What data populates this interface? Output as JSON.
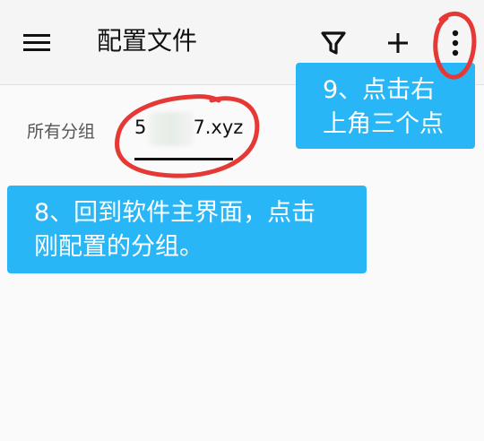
{
  "app_bar": {
    "title": "配置文件",
    "menu_icon": "menu-icon",
    "filter_icon": "filter-icon",
    "add_icon": "plus-icon",
    "more_icon": "more-vert-icon"
  },
  "tabs": {
    "all_groups": "所有分组",
    "group_prefix": "5",
    "group_suffix": "7.xyz"
  },
  "annotations": {
    "step9_line1": "9、点击右",
    "step9_line2": "上角三个点",
    "step8_line1": "8、回到软件主界面，点击",
    "step8_line2": "刚配置的分组。"
  },
  "colors": {
    "callout": "#29b6f6",
    "annotation_circle": "#e53935",
    "background": "#fafafa"
  }
}
